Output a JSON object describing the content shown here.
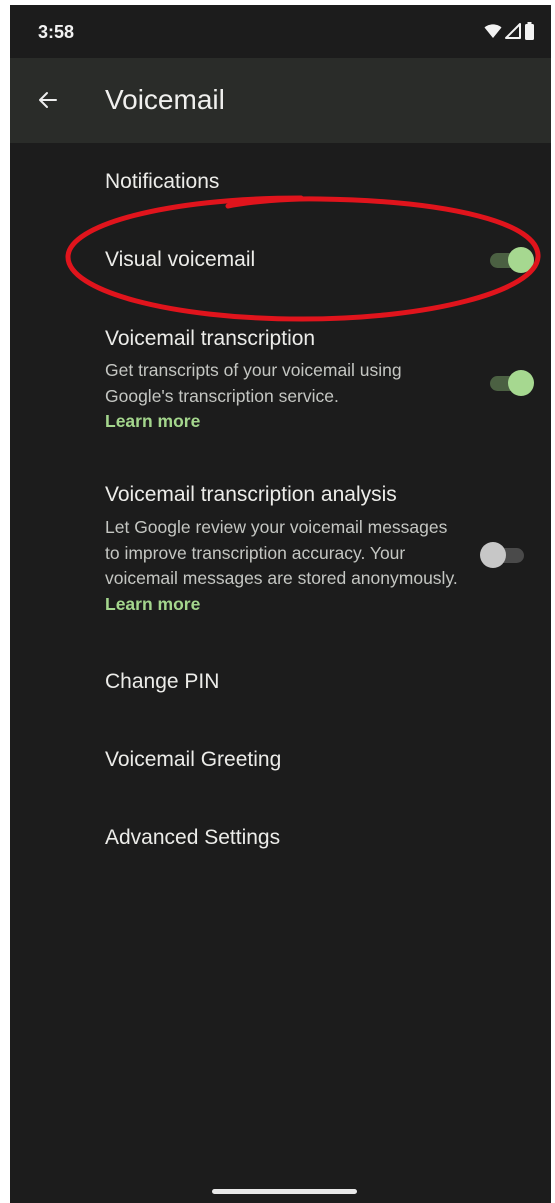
{
  "status_bar": {
    "time": "3:58",
    "icons": [
      "wifi-icon",
      "signal-icon",
      "battery-icon"
    ]
  },
  "app_bar": {
    "back_icon": "arrow-left-icon",
    "title": "Voicemail"
  },
  "settings": {
    "notifications": {
      "title": "Notifications"
    },
    "visual_voicemail": {
      "title": "Visual voicemail",
      "enabled": true
    },
    "transcription": {
      "title": "Voicemail transcription",
      "summary": "Get transcripts of your voicemail using Google's transcription service.",
      "link": "Learn more",
      "enabled": true
    },
    "transcription_analysis": {
      "title": "Voicemail transcription analysis",
      "summary": "Let Google review your voicemail messages to improve transcription accuracy. Your voicemail messages are stored anonymously.",
      "link": "Learn more",
      "enabled": false
    },
    "change_pin": {
      "title": "Change PIN"
    },
    "greeting": {
      "title": "Voicemail Greeting"
    },
    "advanced": {
      "title": "Advanced Settings"
    }
  },
  "colors": {
    "background": "#1c1c1c",
    "app_bar": "#2a2c29",
    "accent": "#a4d68d",
    "annotation": "#e0141c"
  }
}
